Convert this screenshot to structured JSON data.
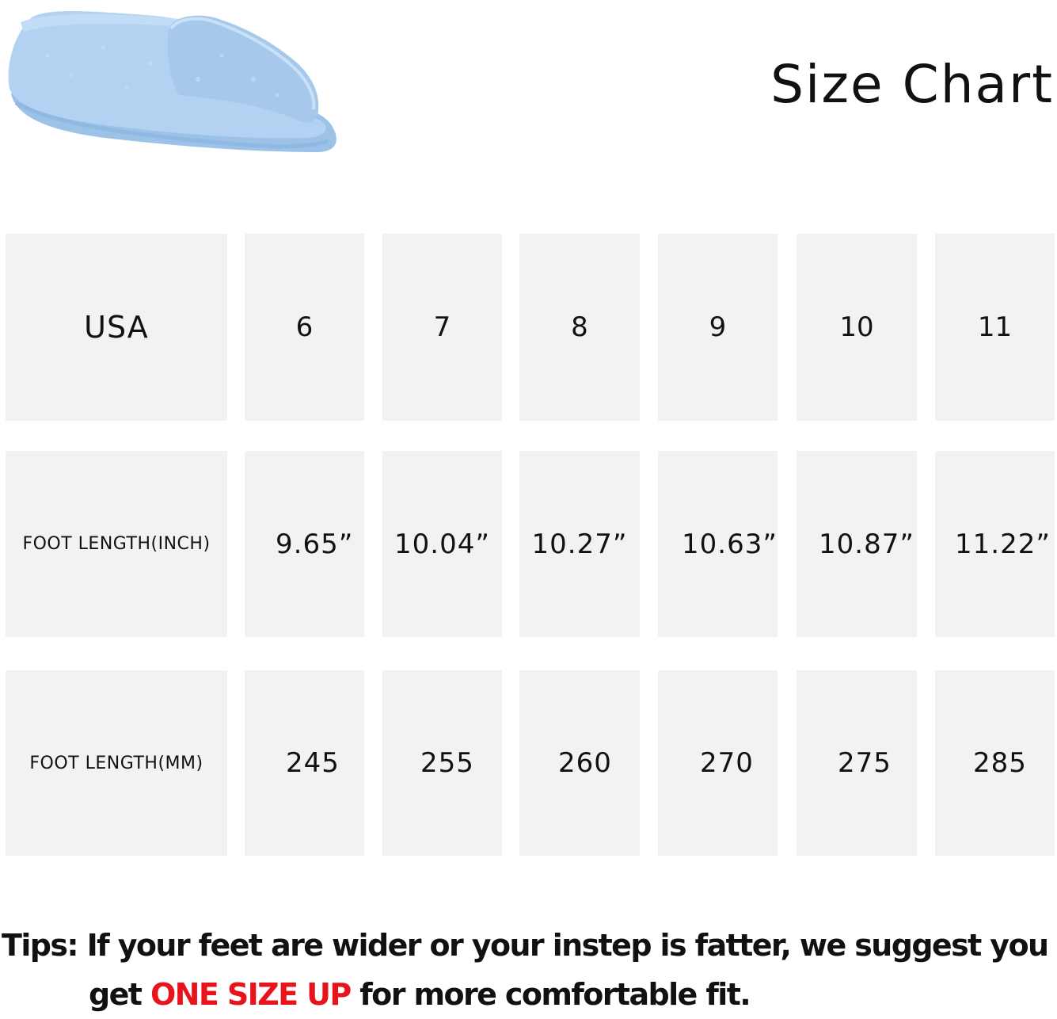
{
  "title": "Size Chart",
  "product_image": "light-blue-slipper",
  "table": {
    "rows": [
      {
        "label": "USA",
        "values": [
          "6",
          "7",
          "8",
          "9",
          "10",
          "11"
        ]
      },
      {
        "label": "FOOT LENGTH(INCH)",
        "values": [
          "9.65”",
          "10.04”",
          "10.27”",
          "10.63”",
          "10.87”",
          "11.22”"
        ]
      },
      {
        "label": "FOOT LENGTH(MM)",
        "values": [
          "245",
          "255",
          "260",
          "270",
          "275",
          "285"
        ]
      }
    ]
  },
  "tips": {
    "line1": "Tips: If your feet are wider or your instep is fatter, we suggest you",
    "line2_prefix": "get ",
    "line2_highlight": "ONE SIZE UP",
    "line2_suffix": " for more comfortable fit."
  },
  "colors": {
    "highlight": "#e8141c",
    "cell_background": "#f2f2f2",
    "slipper": "#a9cbed"
  }
}
